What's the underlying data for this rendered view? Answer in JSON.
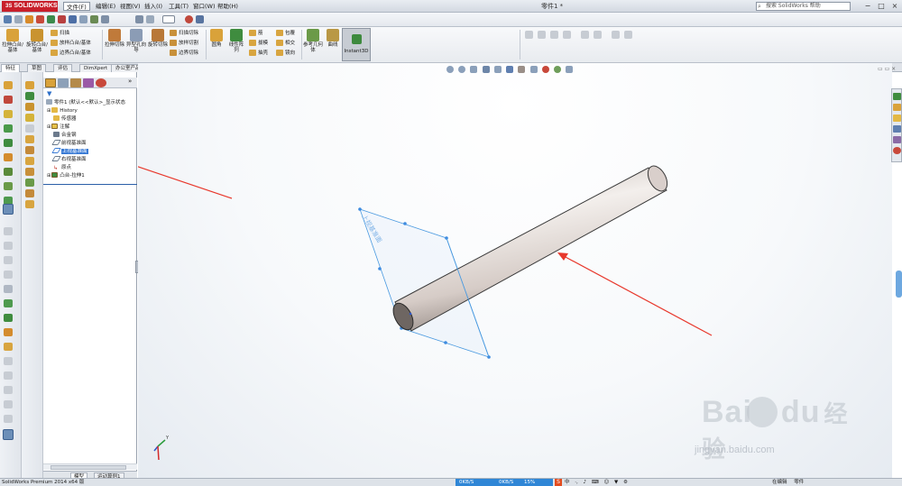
{
  "app": {
    "logo_text": "SOLIDWORKS",
    "logo_prefix": "3S",
    "document_title": "零件1 *",
    "search_placeholder": "搜索 SolidWorks 帮助",
    "menu": [
      "文件(F)",
      "编辑(E)",
      "视图(V)",
      "插入(I)",
      "工具(T)",
      "窗口(W)",
      "帮助(H)"
    ]
  },
  "command_manager": {
    "big": [
      "拉伸凸台/基体",
      "旋转凸台/基体",
      "拉伸切除",
      "异型孔向导",
      "旋转切除",
      "圆角",
      "线性阵列",
      "参考几何体",
      "曲线"
    ],
    "small_group1": [
      "扫描",
      "放样凸台/基体",
      "边界凸台/基体"
    ],
    "small_group2": [
      "扫描切除",
      "放样切割",
      "边界切除"
    ],
    "small_group3": [
      "筋",
      "拔模",
      "抽壳"
    ],
    "small_group4": [
      "包覆",
      "相交",
      "镜向"
    ],
    "instant3d": "Instant3D"
  },
  "tabs": [
    "特征",
    "草图",
    "评估",
    "DimXpert",
    "办公室产品"
  ],
  "feature_tree": {
    "root": "零件1 (默认<<默认>_显示状态",
    "items": [
      {
        "label": "History",
        "icon": "folder-icon"
      },
      {
        "label": "传感器",
        "icon": "sensor-icon"
      },
      {
        "label": "注解",
        "icon": "annotation-icon"
      },
      {
        "label": "合金钢",
        "icon": "material-icon"
      },
      {
        "label": "前视基准面",
        "icon": "plane-icon"
      },
      {
        "label": "上视基准面",
        "icon": "plane-icon",
        "selected": true
      },
      {
        "label": "右视基准面",
        "icon": "plane-icon"
      },
      {
        "label": "原点",
        "icon": "origin-icon"
      },
      {
        "label": "凸台-拉伸1",
        "icon": "extrude-icon"
      }
    ],
    "bottom_tabs": [
      "模型",
      "运动算例1"
    ]
  },
  "status": {
    "left": "SolidWorks Premium 2014 x64 版",
    "mid_items": [
      "0KB/S",
      "0KB/S",
      "15%"
    ],
    "ime_label": "中",
    "right_items": [
      "在编辑",
      "零件"
    ]
  },
  "watermark": {
    "main": "Bai",
    "main2": "du",
    "cn": "经验",
    "url": "jingyan.baidu.com"
  },
  "colors": {
    "accent": "#c8202b",
    "selection": "#3a7bd5",
    "arrow": "#e8382c",
    "plane": "#4a9ae0"
  }
}
